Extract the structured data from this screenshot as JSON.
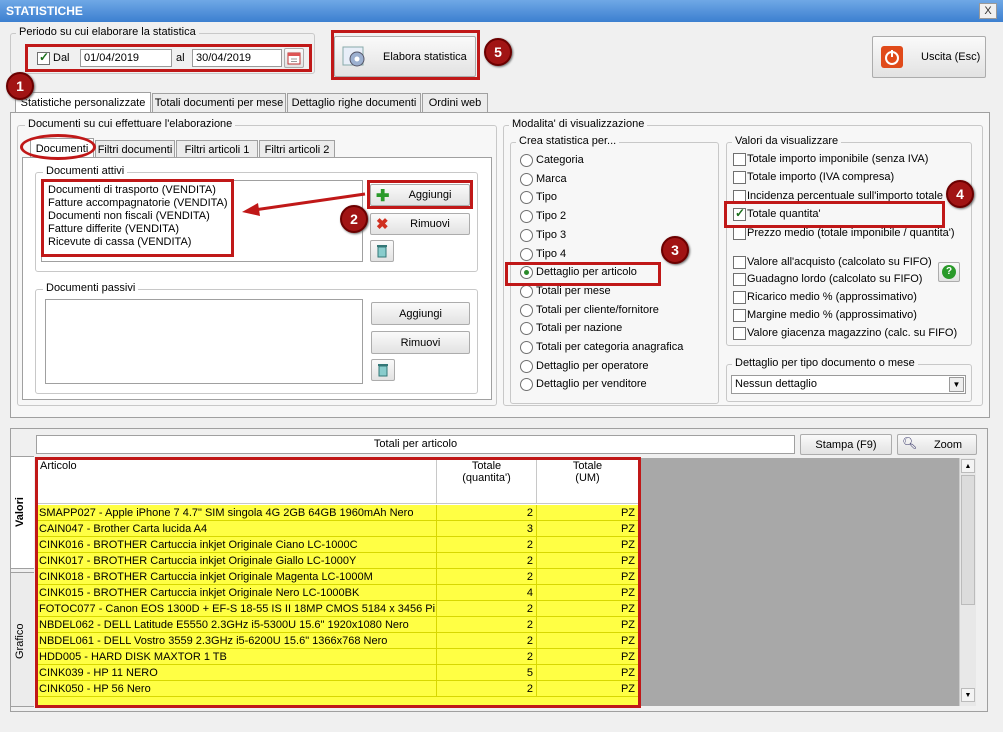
{
  "window": {
    "title": "STATISTICHE",
    "close_label": "X"
  },
  "period": {
    "group_label": "Periodo su cui elaborare la statistica",
    "dal_label": "Dal",
    "dal_checked": true,
    "from_date": "01/04/2019",
    "al_label": "al",
    "to_date": "30/04/2019"
  },
  "elabora_label": "Elabora statistica",
  "uscita_label": "Uscita (Esc)",
  "badges": [
    "1",
    "2",
    "3",
    "4",
    "5"
  ],
  "main_tabs": [
    "Statistiche personalizzate",
    "Totali documenti per mese",
    "Dettaglio righe documenti",
    "Ordini web"
  ],
  "documenti_group": {
    "label": "Documenti su cui effettuare l'elaborazione",
    "tabs": [
      "Documenti",
      "Filtri documenti",
      "Filtri articoli 1",
      "Filtri articoli 2"
    ],
    "attivi_label": "Documenti attivi",
    "attivi_items": [
      "Documenti di trasporto (VENDITA)",
      "Fatture accompagnatorie (VENDITA)",
      "Documenti non fiscali (VENDITA)",
      "Fatture differite (VENDITA)",
      "Ricevute di cassa (VENDITA)"
    ],
    "aggiungi_label": "Aggiungi",
    "rimuovi_label": "Rimuovi",
    "passivi_label": "Documenti passivi"
  },
  "modalita": {
    "label": "Modalita' di visualizzazione",
    "crea_label": "Crea statistica per...",
    "options": [
      "Categoria",
      "Marca",
      "Tipo",
      "Tipo 2",
      "Tipo 3",
      "Tipo 4",
      "Dettaglio per articolo",
      "Totali per mese",
      "Totali per cliente/fornitore",
      "Totali per nazione",
      "Totali per categoria anagrafica",
      "Dettaglio per operatore",
      "Dettaglio per venditore"
    ],
    "selected_index": 6,
    "valori_label": "Valori da visualizzare",
    "valori": [
      {
        "label": "Totale importo imponibile (senza IVA)",
        "checked": false
      },
      {
        "label": "Totale importo (IVA compresa)",
        "checked": false
      },
      {
        "label": "Incidenza percentuale sull'importo totale",
        "checked": false
      },
      {
        "label": "Totale quantita'",
        "checked": true
      },
      {
        "label": "Prezzo medio (totale imponibile / quantita')",
        "checked": false
      },
      {
        "label": "Valore all'acquisto (calcolato su FIFO)",
        "checked": false
      },
      {
        "label": "Guadagno lordo (calcolato su FIFO)",
        "checked": false
      },
      {
        "label": "Ricarico medio % (approssimativo)",
        "checked": false
      },
      {
        "label": "Margine medio % (approssimativo)",
        "checked": false
      },
      {
        "label": "Valore giacenza magazzino (calc. su FIFO)",
        "checked": false
      }
    ],
    "help_label": "?",
    "dettaglio_label": "Dettaglio per tipo documento o mese",
    "dettaglio_value": "Nessun dettaglio"
  },
  "results": {
    "title": "Totali per articolo",
    "stampa_label": "Stampa (F9)",
    "zoom_label": "Zoom",
    "side_tabs": [
      "Valori",
      "Grafico"
    ],
    "columns": [
      "Articolo",
      "Totale\n(quantita')",
      "Totale\n(UM)"
    ],
    "rows": [
      [
        "SMAPP027 - Apple iPhone 7 4.7\" SIM singola 4G 2GB 64GB 1960mAh Nero",
        "2",
        "PZ"
      ],
      [
        "CAIN047 - Brother Carta lucida A4",
        "3",
        "PZ"
      ],
      [
        "CINK016 - BROTHER Cartuccia inkjet Originale Ciano LC-1000C",
        "2",
        "PZ"
      ],
      [
        "CINK017 - BROTHER Cartuccia inkjet Originale Giallo LC-1000Y",
        "2",
        "PZ"
      ],
      [
        "CINK018 - BROTHER Cartuccia inkjet Originale Magenta LC-1000M",
        "2",
        "PZ"
      ],
      [
        "CINK015 - BROTHER Cartuccia inkjet Originale Nero LC-1000BK",
        "4",
        "PZ"
      ],
      [
        "FOTOC077 - Canon EOS 1300D + EF-S 18-55 IS II 18MP CMOS 5184 x 3456 Pi...",
        "2",
        "PZ"
      ],
      [
        "NBDEL062 - DELL Latitude E5550 2.3GHz i5-5300U 15.6\" 1920x1080 Nero",
        "2",
        "PZ"
      ],
      [
        "NBDEL061 - DELL Vostro 3559 2.3GHz i5-6200U 15.6\" 1366x768 Nero",
        "2",
        "PZ"
      ],
      [
        "HDD005 - HARD DISK MAXTOR 1 TB",
        "2",
        "PZ"
      ],
      [
        "CINK039 - HP 11 NERO",
        "5",
        "PZ"
      ],
      [
        "CINK050 - HP 56 Nero",
        "2",
        "PZ"
      ]
    ]
  },
  "colors": {
    "highlight": "#c01818",
    "row_yellow": "#ffff44",
    "titlebar": "#3c7fd0"
  }
}
